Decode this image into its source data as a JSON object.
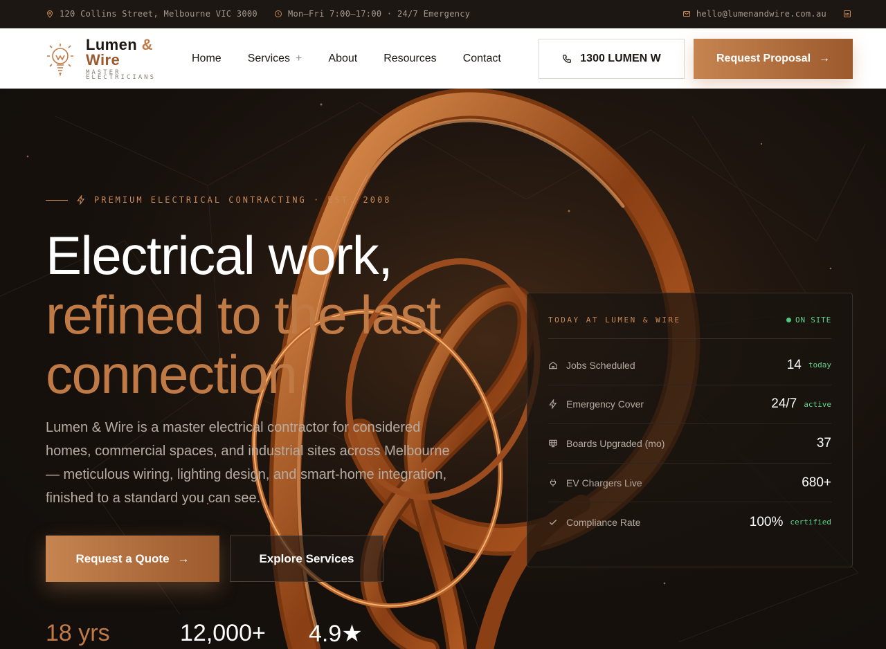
{
  "topbar": {
    "address": "120 Collins Street, Melbourne VIC 3000",
    "hours": "Mon–Fri 7:00–17:00 · 24/7 Emergency",
    "email": "hello@lumenandwire.com.au",
    "social_icon": "linkedin-icon"
  },
  "brand": {
    "name_part1": "Lumen",
    "amp": "&",
    "name_part2": "Wire",
    "tagline": "MASTER ELECTRICIANS"
  },
  "nav": {
    "items": [
      {
        "label": "Home"
      },
      {
        "label": "Services",
        "expand": "+"
      },
      {
        "label": "About"
      },
      {
        "label": "Resources"
      },
      {
        "label": "Contact"
      }
    ],
    "phone_label": "1300 LUMEN W",
    "proposal_label": "Request Proposal"
  },
  "hero": {
    "eyebrow": "PREMIUM ELECTRICAL CONTRACTING · EST. 2008",
    "headline_line1": "Electrical work,",
    "headline_line2": "refined to the last",
    "headline_line3": "connection",
    "lead": "Lumen & Wire is a master electrical contractor for considered homes, commercial spaces, and industrial sites across Melbourne — meticulous wiring, lighting design, and smart-home integration, finished to a standard you can see.",
    "cta_primary": "Request a Quote",
    "cta_secondary": "Explore Services",
    "stats": [
      "18 yrs",
      "12,000+",
      "4.9★"
    ]
  },
  "status_card": {
    "title": "TODAY AT LUMEN & WIRE",
    "status": "ON SITE",
    "status_color": "#4cc97a",
    "rows": [
      {
        "icon": "home-icon",
        "label": "Jobs Scheduled",
        "value": "14",
        "sub": "today"
      },
      {
        "icon": "bolt-icon",
        "label": "Emergency Cover",
        "value": "24/7",
        "sub": "active"
      },
      {
        "icon": "panel-icon",
        "label": "Boards Upgraded (mo)",
        "value": "37",
        "sub": ""
      },
      {
        "icon": "plug-icon",
        "label": "EV Chargers Live",
        "value": "680+",
        "sub": ""
      },
      {
        "icon": "check-icon",
        "label": "Compliance Rate",
        "value": "100%",
        "sub": "certified"
      }
    ]
  },
  "colors": {
    "accent": "#c07a45",
    "accent_dark": "#9c5a2d",
    "background": "#16110d"
  }
}
